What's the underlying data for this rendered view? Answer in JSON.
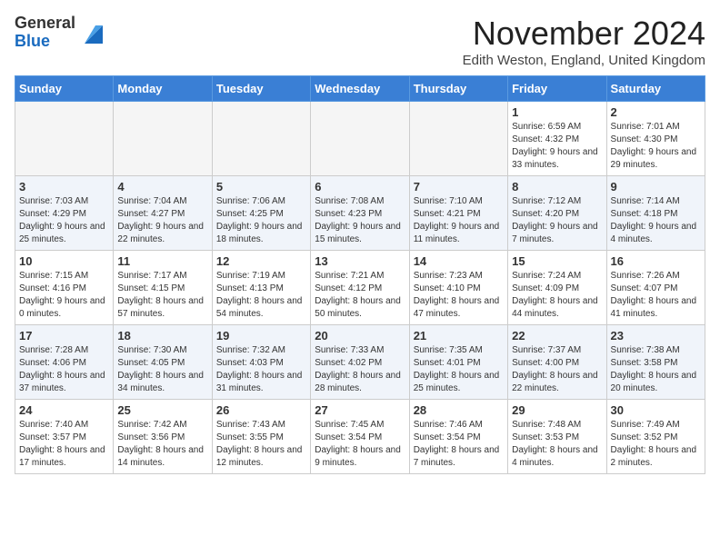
{
  "logo": {
    "general": "General",
    "blue": "Blue"
  },
  "title": "November 2024",
  "location": "Edith Weston, England, United Kingdom",
  "weekdays": [
    "Sunday",
    "Monday",
    "Tuesday",
    "Wednesday",
    "Thursday",
    "Friday",
    "Saturday"
  ],
  "weeks": [
    [
      {
        "num": "",
        "detail": ""
      },
      {
        "num": "",
        "detail": ""
      },
      {
        "num": "",
        "detail": ""
      },
      {
        "num": "",
        "detail": ""
      },
      {
        "num": "",
        "detail": ""
      },
      {
        "num": "1",
        "detail": "Sunrise: 6:59 AM\nSunset: 4:32 PM\nDaylight: 9 hours and 33 minutes."
      },
      {
        "num": "2",
        "detail": "Sunrise: 7:01 AM\nSunset: 4:30 PM\nDaylight: 9 hours and 29 minutes."
      }
    ],
    [
      {
        "num": "3",
        "detail": "Sunrise: 7:03 AM\nSunset: 4:29 PM\nDaylight: 9 hours and 25 minutes."
      },
      {
        "num": "4",
        "detail": "Sunrise: 7:04 AM\nSunset: 4:27 PM\nDaylight: 9 hours and 22 minutes."
      },
      {
        "num": "5",
        "detail": "Sunrise: 7:06 AM\nSunset: 4:25 PM\nDaylight: 9 hours and 18 minutes."
      },
      {
        "num": "6",
        "detail": "Sunrise: 7:08 AM\nSunset: 4:23 PM\nDaylight: 9 hours and 15 minutes."
      },
      {
        "num": "7",
        "detail": "Sunrise: 7:10 AM\nSunset: 4:21 PM\nDaylight: 9 hours and 11 minutes."
      },
      {
        "num": "8",
        "detail": "Sunrise: 7:12 AM\nSunset: 4:20 PM\nDaylight: 9 hours and 7 minutes."
      },
      {
        "num": "9",
        "detail": "Sunrise: 7:14 AM\nSunset: 4:18 PM\nDaylight: 9 hours and 4 minutes."
      }
    ],
    [
      {
        "num": "10",
        "detail": "Sunrise: 7:15 AM\nSunset: 4:16 PM\nDaylight: 9 hours and 0 minutes."
      },
      {
        "num": "11",
        "detail": "Sunrise: 7:17 AM\nSunset: 4:15 PM\nDaylight: 8 hours and 57 minutes."
      },
      {
        "num": "12",
        "detail": "Sunrise: 7:19 AM\nSunset: 4:13 PM\nDaylight: 8 hours and 54 minutes."
      },
      {
        "num": "13",
        "detail": "Sunrise: 7:21 AM\nSunset: 4:12 PM\nDaylight: 8 hours and 50 minutes."
      },
      {
        "num": "14",
        "detail": "Sunrise: 7:23 AM\nSunset: 4:10 PM\nDaylight: 8 hours and 47 minutes."
      },
      {
        "num": "15",
        "detail": "Sunrise: 7:24 AM\nSunset: 4:09 PM\nDaylight: 8 hours and 44 minutes."
      },
      {
        "num": "16",
        "detail": "Sunrise: 7:26 AM\nSunset: 4:07 PM\nDaylight: 8 hours and 41 minutes."
      }
    ],
    [
      {
        "num": "17",
        "detail": "Sunrise: 7:28 AM\nSunset: 4:06 PM\nDaylight: 8 hours and 37 minutes."
      },
      {
        "num": "18",
        "detail": "Sunrise: 7:30 AM\nSunset: 4:05 PM\nDaylight: 8 hours and 34 minutes."
      },
      {
        "num": "19",
        "detail": "Sunrise: 7:32 AM\nSunset: 4:03 PM\nDaylight: 8 hours and 31 minutes."
      },
      {
        "num": "20",
        "detail": "Sunrise: 7:33 AM\nSunset: 4:02 PM\nDaylight: 8 hours and 28 minutes."
      },
      {
        "num": "21",
        "detail": "Sunrise: 7:35 AM\nSunset: 4:01 PM\nDaylight: 8 hours and 25 minutes."
      },
      {
        "num": "22",
        "detail": "Sunrise: 7:37 AM\nSunset: 4:00 PM\nDaylight: 8 hours and 22 minutes."
      },
      {
        "num": "23",
        "detail": "Sunrise: 7:38 AM\nSunset: 3:58 PM\nDaylight: 8 hours and 20 minutes."
      }
    ],
    [
      {
        "num": "24",
        "detail": "Sunrise: 7:40 AM\nSunset: 3:57 PM\nDaylight: 8 hours and 17 minutes."
      },
      {
        "num": "25",
        "detail": "Sunrise: 7:42 AM\nSunset: 3:56 PM\nDaylight: 8 hours and 14 minutes."
      },
      {
        "num": "26",
        "detail": "Sunrise: 7:43 AM\nSunset: 3:55 PM\nDaylight: 8 hours and 12 minutes."
      },
      {
        "num": "27",
        "detail": "Sunrise: 7:45 AM\nSunset: 3:54 PM\nDaylight: 8 hours and 9 minutes."
      },
      {
        "num": "28",
        "detail": "Sunrise: 7:46 AM\nSunset: 3:54 PM\nDaylight: 8 hours and 7 minutes."
      },
      {
        "num": "29",
        "detail": "Sunrise: 7:48 AM\nSunset: 3:53 PM\nDaylight: 8 hours and 4 minutes."
      },
      {
        "num": "30",
        "detail": "Sunrise: 7:49 AM\nSunset: 3:52 PM\nDaylight: 8 hours and 2 minutes."
      }
    ]
  ]
}
